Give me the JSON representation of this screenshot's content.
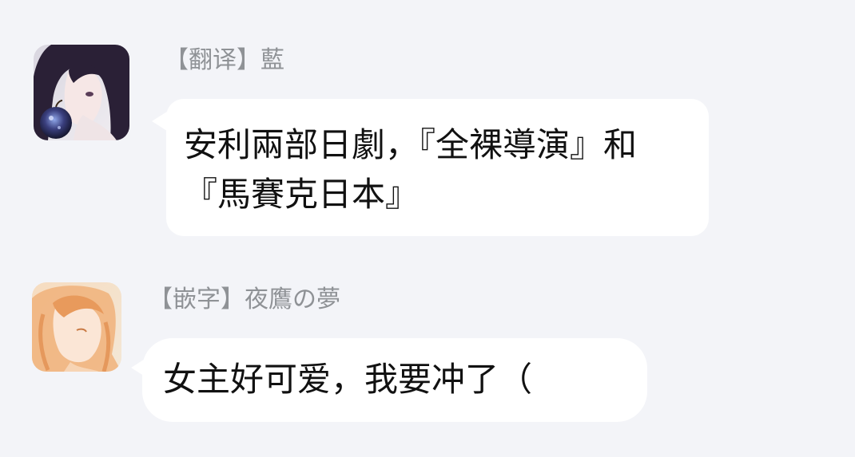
{
  "messages": [
    {
      "sender": "【翻译】藍",
      "text": "安利兩部日劇，『全裸導演』和『馬賽克日本』",
      "avatar": "anime-girl-holding-apple-avatar"
    },
    {
      "sender": "【嵌字】夜鷹の夢",
      "text": "女主好可爱，我要冲了（",
      "avatar": "anime-girl-orange-hair-avatar"
    }
  ],
  "colors": {
    "background": "#f3f4f8",
    "bubble": "#ffffff",
    "sender_name": "#8f9296",
    "message_text": "#111111"
  }
}
